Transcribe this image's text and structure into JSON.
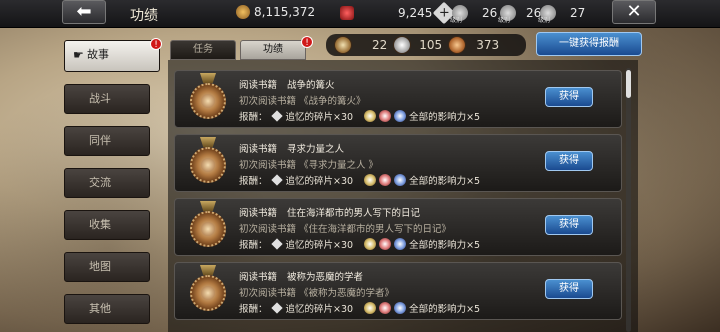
{
  "topbar": {
    "back_label": "⬅",
    "title": "功绩",
    "gold": "8,115,372",
    "gems": "9,245",
    "plus_label": "+",
    "ranks": [
      {
        "tag": "级别",
        "value": "26"
      },
      {
        "tag": "级别",
        "value": "26"
      },
      {
        "tag": "级别",
        "value": "27"
      }
    ],
    "close_label": "✕"
  },
  "sidebar": {
    "items": [
      {
        "label": "故事",
        "active": true,
        "badge": "!"
      },
      {
        "label": "战斗"
      },
      {
        "label": "同伴"
      },
      {
        "label": "交流"
      },
      {
        "label": "收集"
      },
      {
        "label": "地图"
      },
      {
        "label": "其他"
      }
    ]
  },
  "tabs": [
    {
      "label": "任务",
      "active": false
    },
    {
      "label": "功绩",
      "active": true,
      "badge": "!"
    }
  ],
  "summary": {
    "gold_count": "22",
    "silver_count": "105",
    "bronze_count": "373"
  },
  "claim_all_label": "一键获得报酬",
  "achievements": [
    {
      "category": "阅读书籍",
      "name": "战争的篝火",
      "desc": "初次阅读书籍 《战争的篝火》",
      "reward_label": "报酬：",
      "reward_item": "追忆的碎片×30",
      "reward_influence": "全部的影响力×5",
      "button": "获得"
    },
    {
      "category": "阅读书籍",
      "name": "寻求力量之人",
      "desc": "初次阅读书籍 《寻求力量之人 》",
      "reward_label": "报酬：",
      "reward_item": "追忆的碎片×30",
      "reward_influence": "全部的影响力×5",
      "button": "获得"
    },
    {
      "category": "阅读书籍",
      "name": "住在海洋都市的男人写下的日记",
      "desc": "初次阅读书籍 《住在海洋都市的男人写下的日记》",
      "reward_label": "报酬：",
      "reward_item": "追忆的碎片×30",
      "reward_influence": "全部的影响力×5",
      "button": "获得"
    },
    {
      "category": "阅读书籍",
      "name": "被称为恶魔的学者",
      "desc": "初次阅读书籍 《被称为恶魔的学者》",
      "reward_label": "报酬：",
      "reward_item": "追忆的碎片×30",
      "reward_influence": "全部的影响力×5",
      "button": "获得"
    }
  ]
}
